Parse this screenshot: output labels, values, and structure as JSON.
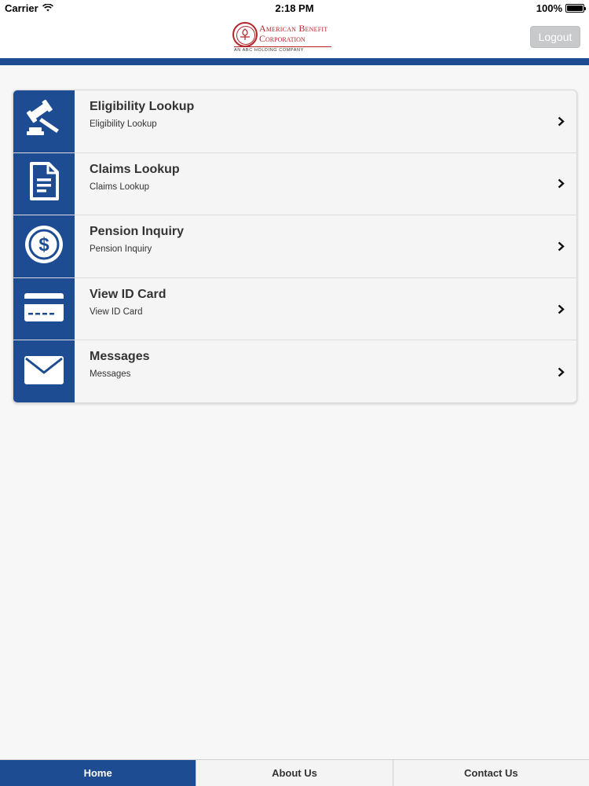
{
  "status_bar": {
    "carrier": "Carrier",
    "time": "2:18 PM",
    "battery": "100%",
    "icons": [
      "wifi-icon",
      "battery-icon"
    ]
  },
  "header": {
    "logo": {
      "line1": "American Benefit",
      "line2": "Corporation",
      "tagline": "AN ABC HOLDING COMPANY"
    },
    "logout_label": "Logout"
  },
  "colors": {
    "brand_blue": "#1d4c93",
    "logo_red": "#b3262b",
    "logout_gray": "#c8c9cb",
    "background": "#f7f7f8"
  },
  "menu": {
    "items": [
      {
        "title": "Eligibility Lookup",
        "subtitle": "Eligibility Lookup",
        "icon": "gavel-icon"
      },
      {
        "title": "Claims Lookup",
        "subtitle": "Claims Lookup",
        "icon": "document-icon"
      },
      {
        "title": "Pension Inquiry",
        "subtitle": "Pension Inquiry",
        "icon": "dollar-coin-icon"
      },
      {
        "title": "View ID Card",
        "subtitle": "View ID Card",
        "icon": "id-card-icon"
      },
      {
        "title": "Messages",
        "subtitle": "Messages",
        "icon": "envelope-icon"
      }
    ]
  },
  "tabs": [
    {
      "label": "Home",
      "active": true
    },
    {
      "label": "About Us",
      "active": false
    },
    {
      "label": "Contact Us",
      "active": false
    }
  ]
}
